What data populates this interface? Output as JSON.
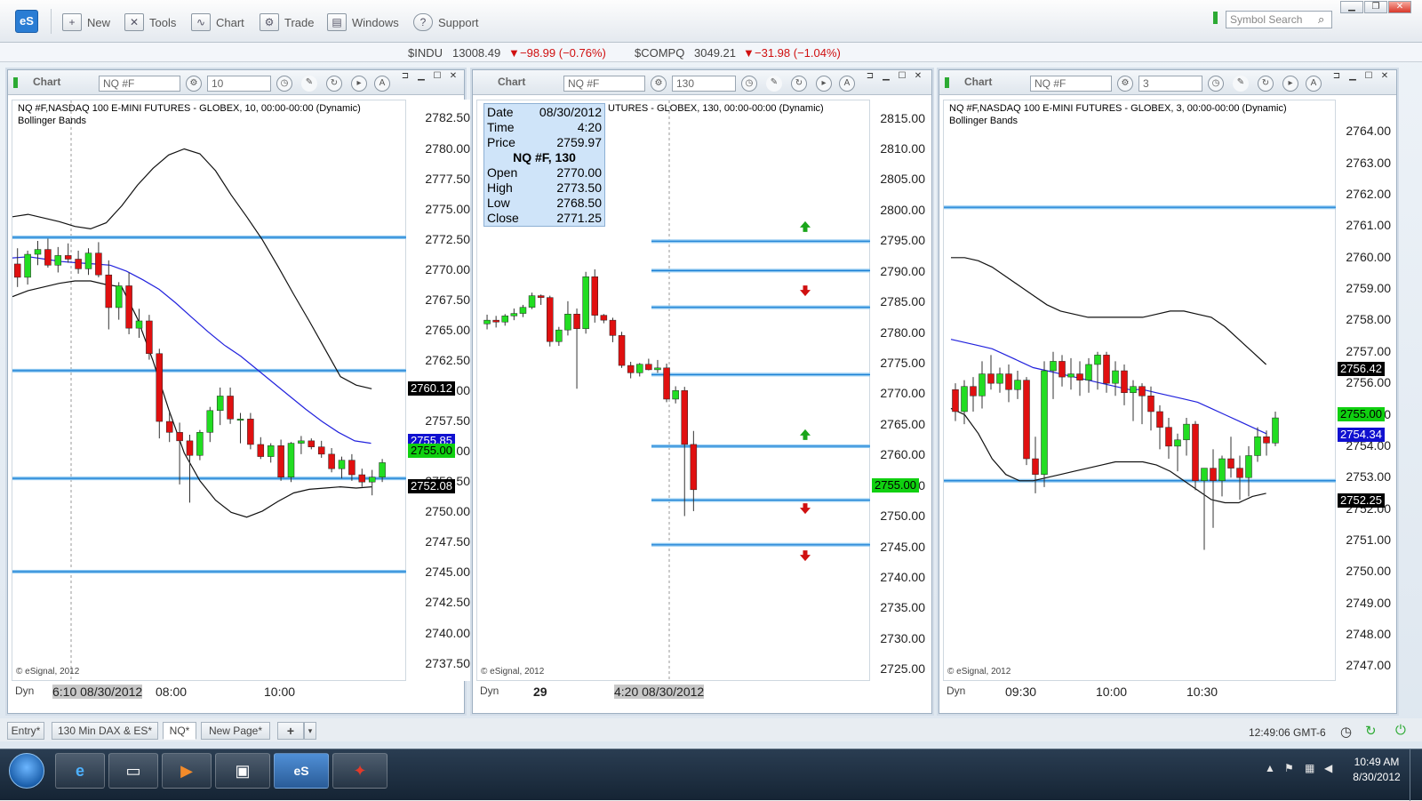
{
  "toolbar": {
    "logo": "eS",
    "items": [
      {
        "label": "New",
        "icon": "new-doc-icon",
        "glyph": "+"
      },
      {
        "label": "Tools",
        "icon": "tools-icon",
        "glyph": "✕"
      },
      {
        "label": "Chart",
        "icon": "chart-icon",
        "glyph": "∿"
      },
      {
        "label": "Trade",
        "icon": "trade-icon",
        "glyph": "⚙"
      },
      {
        "label": "Windows",
        "icon": "windows-icon",
        "glyph": "▤"
      },
      {
        "label": "Support",
        "icon": "support-icon",
        "glyph": "?"
      }
    ],
    "symbol_search_placeholder": "Symbol Search"
  },
  "ticker": {
    "indu_sym": "$INDU",
    "indu_val": "13008.49",
    "indu_chg": "−98.99 (−0.76%)",
    "comp_sym": "$COMPQ",
    "comp_val": "3049.21",
    "comp_chg": "−31.98 (−1.04%)"
  },
  "panels": [
    {
      "title": "Chart",
      "symbol": "NQ #F",
      "interval": "10",
      "info1": "NQ #F,NASDAQ 100 E-MINI FUTURES - GLOBEX, 10, 00:00-00:00 (Dynamic)",
      "info2": "Bollinger Bands",
      "copyright": "© eSignal, 2012",
      "ylim": [
        2736,
        2784
      ],
      "yticks": [
        "2782.50",
        "2780.00",
        "2777.50",
        "2775.00",
        "2772.50",
        "2770.00",
        "2767.50",
        "2765.00",
        "2762.50",
        "2760.00",
        "2757.50",
        "2755.00",
        "2752.50",
        "2750.00",
        "2747.50",
        "2745.00",
        "2742.50",
        "2740.00",
        "2737.50"
      ],
      "tags": [
        {
          "text": "2760.12",
          "bg": "#000",
          "fg": "#fff",
          "v": 2760.12
        },
        {
          "text": "2755.85",
          "bg": "#1010d0",
          "fg": "#fff",
          "v": 2755.85
        },
        {
          "text": "2755.00",
          "bg": "#10d010",
          "fg": "#000",
          "v": 2755.0
        },
        {
          "text": "2752.08",
          "bg": "#000",
          "fg": "#fff",
          "v": 2752.08
        }
      ],
      "dyn": "Dyn",
      "xlabels": [
        "6:10 08/30/2012",
        "08:00",
        "10:00"
      ]
    },
    {
      "title": "Chart",
      "symbol": "NQ #F",
      "interval": "130",
      "info1": "UTURES - GLOBEX, 130, 00:00-00:00 (Dynamic)",
      "info2": "",
      "copyright": "© eSignal, 2012",
      "ylim": [
        2723,
        2818
      ],
      "yticks": [
        "2815.00",
        "2810.00",
        "2805.00",
        "2800.00",
        "2795.00",
        "2790.00",
        "2785.00",
        "2780.00",
        "2775.00",
        "2770.00",
        "2765.00",
        "2760.00",
        "2755.00",
        "2750.00",
        "2745.00",
        "2740.00",
        "2735.00",
        "2730.00",
        "2725.00"
      ],
      "tags": [
        {
          "text": "2755.00",
          "bg": "#10d010",
          "fg": "#000",
          "v": 2755.0
        }
      ],
      "dyn": "Dyn",
      "xlabels": [
        "29",
        "4:20 08/30/2012"
      ],
      "data_window": {
        "date_k": "Date",
        "date_v": "08/30/2012",
        "time_k": "Time",
        "time_v": "4:20",
        "price_k": "Price",
        "price_v": "2759.97",
        "title": "NQ #F, 130",
        "open_k": "Open",
        "open_v": "2770.00",
        "high_k": "High",
        "high_v": "2773.50",
        "low_k": "Low",
        "low_v": "2768.50",
        "close_k": "Close",
        "close_v": "2771.25"
      }
    },
    {
      "title": "Chart",
      "symbol": "NQ #F",
      "interval": "3",
      "info1": "NQ #F,NASDAQ 100 E-MINI FUTURES - GLOBEX, 3, 00:00-00:00 (Dynamic)",
      "info2": "Bollinger Bands",
      "copyright": "© eSignal, 2012",
      "ylim": [
        2746.5,
        2765
      ],
      "yticks": [
        "2764.00",
        "2763.00",
        "2762.00",
        "2761.00",
        "2760.00",
        "2759.00",
        "2758.00",
        "2757.00",
        "2756.00",
        "2755.00",
        "2754.00",
        "2753.00",
        "2752.00",
        "2751.00",
        "2750.00",
        "2749.00",
        "2748.00",
        "2747.00"
      ],
      "tags": [
        {
          "text": "2756.42",
          "bg": "#000",
          "fg": "#fff",
          "v": 2756.42
        },
        {
          "text": "2755.00",
          "bg": "#10d010",
          "fg": "#000",
          "v": 2755.0
        },
        {
          "text": "2754.34",
          "bg": "#1010d0",
          "fg": "#fff",
          "v": 2754.34
        },
        {
          "text": "2752.25",
          "bg": "#000",
          "fg": "#fff",
          "v": 2752.25
        }
      ],
      "dyn": "Dyn",
      "xlabels": [
        "09:30",
        "10:00",
        "10:30"
      ]
    }
  ],
  "tabs": [
    "Entry*",
    "130 Min DAX & ES*",
    "NQ*",
    "New Page*",
    "+"
  ],
  "status": {
    "time": "12:49:06 GMT-6"
  },
  "taskbar": {
    "time": "10:49 AM",
    "date": "8/30/2012"
  },
  "chart_data": [
    {
      "type": "candlestick",
      "symbol": "NQ #F",
      "interval": "10",
      "ohlc": [
        [
          2770.5,
          2771.8,
          2768.6,
          2769.4
        ],
        [
          2769.4,
          2771.6,
          2768.8,
          2771.3
        ],
        [
          2771.3,
          2772.4,
          2770.4,
          2771.7
        ],
        [
          2771.7,
          2772.6,
          2770.2,
          2770.4
        ],
        [
          2770.4,
          2771.9,
          2769.8,
          2771.2
        ],
        [
          2771.2,
          2772.2,
          2770.6,
          2770.9
        ],
        [
          2770.9,
          2771.6,
          2769.7,
          2770.1
        ],
        [
          2770.1,
          2771.8,
          2769.6,
          2771.4
        ],
        [
          2771.4,
          2772.3,
          2769.4,
          2769.6
        ],
        [
          2769.6,
          2770.8,
          2765.1,
          2766.9
        ],
        [
          2766.9,
          2769.0,
          2765.9,
          2768.7
        ],
        [
          2768.7,
          2769.8,
          2764.7,
          2765.2
        ],
        [
          2765.2,
          2766.8,
          2764.4,
          2765.8
        ],
        [
          2765.8,
          2766.3,
          2762.6,
          2763.1
        ],
        [
          2763.1,
          2763.5,
          2756.1,
          2757.5
        ],
        [
          2757.5,
          2758.3,
          2755.8,
          2756.6
        ],
        [
          2756.6,
          2757.4,
          2752.3,
          2755.9
        ],
        [
          2755.9,
          2756.4,
          2750.8,
          2754.7
        ],
        [
          2754.7,
          2756.8,
          2754.3,
          2756.6
        ],
        [
          2756.6,
          2758.7,
          2755.8,
          2758.4
        ],
        [
          2758.4,
          2760.3,
          2757.2,
          2759.6
        ],
        [
          2759.6,
          2760.3,
          2757.3,
          2757.7
        ],
        [
          2757.7,
          2758.2,
          2755.7,
          2757.7
        ],
        [
          2757.7,
          2758.2,
          2755.2,
          2755.6
        ],
        [
          2755.6,
          2756.2,
          2754.4,
          2754.6
        ],
        [
          2754.6,
          2755.7,
          2754.1,
          2755.5
        ],
        [
          2755.5,
          2756.0,
          2752.6,
          2752.9
        ],
        [
          2752.9,
          2755.8,
          2752.5,
          2755.7
        ],
        [
          2755.7,
          2756.3,
          2754.8,
          2755.9
        ],
        [
          2755.9,
          2756.1,
          2755.2,
          2755.4
        ],
        [
          2755.4,
          2755.9,
          2754.5,
          2754.8
        ],
        [
          2754.8,
          2755.3,
          2753.3,
          2753.6
        ],
        [
          2753.6,
          2754.6,
          2752.8,
          2754.3
        ],
        [
          2754.3,
          2754.8,
          2752.6,
          2753.1
        ],
        [
          2753.1,
          2753.6,
          2752.1,
          2752.5
        ],
        [
          2752.5,
          2753.5,
          2751.4,
          2752.9
        ],
        [
          2752.9,
          2754.4,
          2752.5,
          2754.1
        ]
      ],
      "bollinger_upper": [
        2774.4,
        2774.6,
        2774.3,
        2774.0,
        2773.6,
        2773.4,
        2773.9,
        2775.3,
        2777.0,
        2778.4,
        2779.5,
        2780.0,
        2779.6,
        2778.2,
        2776.2,
        2774.4,
        2772.5,
        2770.3,
        2768.0,
        2765.8,
        2763.5,
        2761.2,
        2760.5,
        2760.2
      ],
      "bollinger_mid": [
        2771.0,
        2771.1,
        2770.9,
        2770.7,
        2770.6,
        2770.5,
        2770.4,
        2769.9,
        2769.2,
        2768.4,
        2767.3,
        2766.1,
        2764.9,
        2763.8,
        2762.9,
        2761.8,
        2760.7,
        2759.6,
        2758.5,
        2757.5,
        2756.6,
        2755.9,
        2755.7
      ],
      "bollinger_lower": [
        2767.8,
        2768.3,
        2768.6,
        2768.9,
        2769.1,
        2769.1,
        2768.8,
        2768.6,
        2766.0,
        2762.5,
        2758.5,
        2754.9,
        2752.6,
        2751.0,
        2750.0,
        2749.6,
        2750.1,
        2750.9,
        2751.6,
        2751.9,
        2752.0,
        2752.1,
        2752.0,
        2752.1
      ],
      "levels": [
        2772.7,
        2761.7,
        2752.8,
        2745.1
      ]
    },
    {
      "type": "candlestick",
      "symbol": "NQ #F",
      "interval": "130",
      "ohlc": [
        [
          2781.5,
          2783.0,
          2780.6,
          2782.1
        ],
        [
          2782.1,
          2782.8,
          2780.9,
          2781.8
        ],
        [
          2781.8,
          2783.1,
          2781.2,
          2782.8
        ],
        [
          2782.8,
          2784.0,
          2782.1,
          2783.2
        ],
        [
          2783.2,
          2784.6,
          2782.6,
          2784.2
        ],
        [
          2784.2,
          2786.6,
          2783.9,
          2786.1
        ],
        [
          2786.1,
          2786.3,
          2784.6,
          2785.8
        ],
        [
          2785.8,
          2786.1,
          2777.8,
          2778.6
        ],
        [
          2778.6,
          2781.0,
          2777.9,
          2780.5
        ],
        [
          2780.5,
          2785.2,
          2779.6,
          2783.1
        ],
        [
          2783.1,
          2784.0,
          2770.9,
          2780.7
        ],
        [
          2780.7,
          2790.0,
          2779.9,
          2789.2
        ],
        [
          2789.2,
          2790.4,
          2781.7,
          2782.9
        ],
        [
          2782.9,
          2783.1,
          2781.6,
          2782.1
        ],
        [
          2782.1,
          2782.5,
          2778.5,
          2779.6
        ],
        [
          2779.6,
          2780.2,
          2774.3,
          2774.7
        ],
        [
          2774.7,
          2775.3,
          2772.6,
          2773.5
        ],
        [
          2773.5,
          2775.1,
          2772.9,
          2774.9
        ],
        [
          2774.9,
          2775.8,
          2773.9,
          2774.0
        ],
        [
          2774.0,
          2775.6,
          2773.5,
          2774.3
        ],
        [
          2774.3,
          2775.0,
          2768.7,
          2769.2
        ],
        [
          2769.2,
          2771.3,
          2768.5,
          2770.6
        ],
        [
          2770.6,
          2771.2,
          2750.1,
          2761.8
        ],
        [
          2761.8,
          2764.0,
          2750.9,
          2754.4
        ]
      ],
      "arrows": [
        {
          "dir": "up",
          "v": 2797.4
        },
        {
          "dir": "down",
          "v": 2786.9
        },
        {
          "dir": "up",
          "v": 2763.4
        },
        {
          "dir": "down",
          "v": 2751.3
        },
        {
          "dir": "down",
          "v": 2743.6
        }
      ],
      "levels": [
        2795.0,
        2790.2,
        2784.2,
        2773.2,
        2761.5,
        2752.7,
        2745.4
      ]
    },
    {
      "type": "candlestick",
      "symbol": "NQ #F",
      "interval": "3",
      "ohlc": [
        [
          2755.8,
          2756.0,
          2754.8,
          2755.1
        ],
        [
          2755.1,
          2756.1,
          2754.7,
          2755.9
        ],
        [
          2755.9,
          2756.2,
          2755.1,
          2755.6
        ],
        [
          2755.6,
          2756.7,
          2755.2,
          2756.3
        ],
        [
          2756.3,
          2756.9,
          2755.8,
          2756.0
        ],
        [
          2756.0,
          2756.5,
          2755.7,
          2756.3
        ],
        [
          2756.3,
          2756.6,
          2755.4,
          2755.8
        ],
        [
          2755.8,
          2756.4,
          2755.5,
          2756.1
        ],
        [
          2756.1,
          2756.2,
          2753.4,
          2753.6
        ],
        [
          2753.6,
          2754.3,
          2752.5,
          2753.1
        ],
        [
          2753.1,
          2756.7,
          2752.7,
          2756.4
        ],
        [
          2756.4,
          2757.0,
          2755.5,
          2756.7
        ],
        [
          2756.7,
          2756.9,
          2755.9,
          2756.2
        ],
        [
          2756.2,
          2756.8,
          2755.8,
          2756.3
        ],
        [
          2756.3,
          2756.7,
          2755.6,
          2756.1
        ],
        [
          2756.1,
          2756.8,
          2755.7,
          2756.6
        ],
        [
          2756.6,
          2757.0,
          2755.8,
          2756.9
        ],
        [
          2756.9,
          2757.0,
          2755.7,
          2756.0
        ],
        [
          2756.0,
          2756.7,
          2755.6,
          2756.4
        ],
        [
          2756.4,
          2756.6,
          2755.3,
          2755.7
        ],
        [
          2755.7,
          2756.1,
          2754.8,
          2755.9
        ],
        [
          2755.9,
          2756.0,
          2754.7,
          2755.6
        ],
        [
          2755.6,
          2755.9,
          2754.5,
          2755.1
        ],
        [
          2755.1,
          2755.3,
          2753.9,
          2754.6
        ],
        [
          2754.6,
          2754.9,
          2753.6,
          2754.0
        ],
        [
          2754.0,
          2754.4,
          2753.2,
          2754.2
        ],
        [
          2754.2,
          2754.9,
          2753.7,
          2754.7
        ],
        [
          2754.7,
          2754.8,
          2752.6,
          2752.9
        ],
        [
          2752.9,
          2753.3,
          2750.7,
          2753.3
        ],
        [
          2753.3,
          2753.9,
          2751.4,
          2752.9
        ],
        [
          2752.9,
          2753.7,
          2752.4,
          2753.6
        ],
        [
          2753.6,
          2754.3,
          2753.0,
          2753.3
        ],
        [
          2753.3,
          2753.7,
          2752.3,
          2753.0
        ],
        [
          2753.0,
          2754.0,
          2752.4,
          2753.7
        ],
        [
          2753.7,
          2754.6,
          2753.5,
          2754.3
        ],
        [
          2754.3,
          2754.5,
          2753.7,
          2754.1
        ],
        [
          2754.1,
          2755.1,
          2754.0,
          2754.9
        ]
      ],
      "bollinger_upper": [
        2760.0,
        2760.0,
        2759.9,
        2759.7,
        2759.4,
        2759.1,
        2758.8,
        2758.5,
        2758.3,
        2758.2,
        2758.1,
        2758.1,
        2758.1,
        2758.1,
        2758.1,
        2758.2,
        2758.3,
        2758.3,
        2758.2,
        2758.1,
        2757.8,
        2757.4,
        2757.0,
        2756.6
      ],
      "bollinger_mid": [
        2757.4,
        2757.3,
        2757.2,
        2757.1,
        2756.9,
        2756.7,
        2756.5,
        2756.4,
        2756.3,
        2756.2,
        2756.1,
        2756.0,
        2755.9,
        2755.8,
        2755.8,
        2755.7,
        2755.6,
        2755.5,
        2755.4,
        2755.2,
        2755.0,
        2754.8,
        2754.6,
        2754.4
      ],
      "bollinger_lower": [
        2755.2,
        2755.0,
        2754.4,
        2753.6,
        2753.1,
        2752.9,
        2752.9,
        2753.0,
        2753.1,
        2753.2,
        2753.3,
        2753.4,
        2753.5,
        2753.5,
        2753.5,
        2753.4,
        2753.2,
        2752.9,
        2752.6,
        2752.3,
        2752.2,
        2752.2,
        2752.4,
        2752.5
      ],
      "levels": [
        2761.6,
        2752.9
      ]
    }
  ]
}
